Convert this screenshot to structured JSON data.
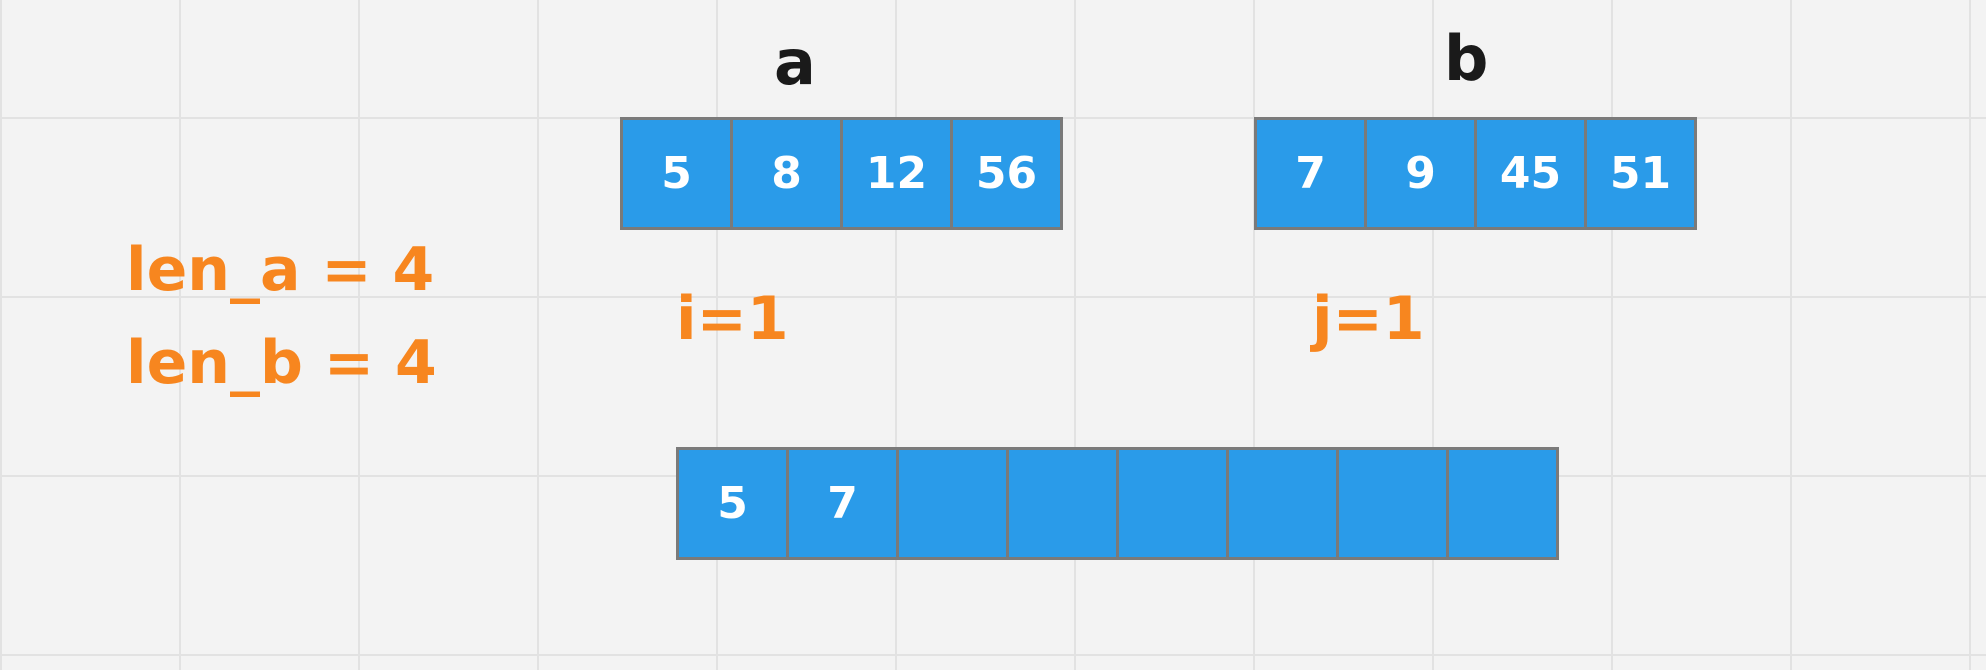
{
  "colors": {
    "accent": "#f7861f",
    "cell": "#2a9be9",
    "border": "#7a7a7a",
    "label": "#1a1a1a"
  },
  "labels": {
    "a": "a",
    "b": "b"
  },
  "array_a": [
    "5",
    "8",
    "12",
    "56"
  ],
  "array_b": [
    "7",
    "9",
    "45",
    "51"
  ],
  "merged": [
    "5",
    "7",
    "",
    "",
    "",
    "",
    "",
    ""
  ],
  "vars": {
    "len_a": "len_a = 4",
    "len_b": "len_b = 4",
    "i": "i=1",
    "j": "j=1"
  }
}
